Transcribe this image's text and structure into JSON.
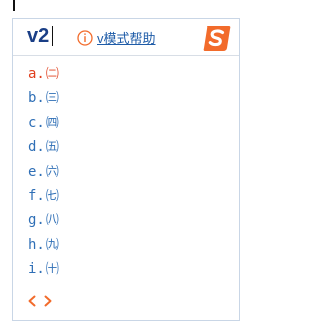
{
  "ime": {
    "composition": "v2",
    "help_label": "v模式帮助",
    "logo_icon": "sogou-s-logo-icon",
    "info_icon": "info-circle-icon",
    "candidates": [
      {
        "key": "a.",
        "char": "㈡"
      },
      {
        "key": "b.",
        "char": "㈢"
      },
      {
        "key": "c.",
        "char": "㈣"
      },
      {
        "key": "d.",
        "char": "㈤"
      },
      {
        "key": "e.",
        "char": "㈥"
      },
      {
        "key": "f.",
        "char": "㈦"
      },
      {
        "key": "g.",
        "char": "㈧"
      },
      {
        "key": "h.",
        "char": "㈨"
      },
      {
        "key": "i.",
        "char": "㈩"
      }
    ],
    "selected_index": 0,
    "pager": {
      "prev_icon": "chevron-left-icon",
      "next_icon": "chevron-right-icon"
    },
    "colors": {
      "composition": "#1a3e86",
      "candidate": "#2f6fb6",
      "selected": "#e0401f",
      "accent": "#f26b2b",
      "border": "#c9d6e6"
    }
  }
}
